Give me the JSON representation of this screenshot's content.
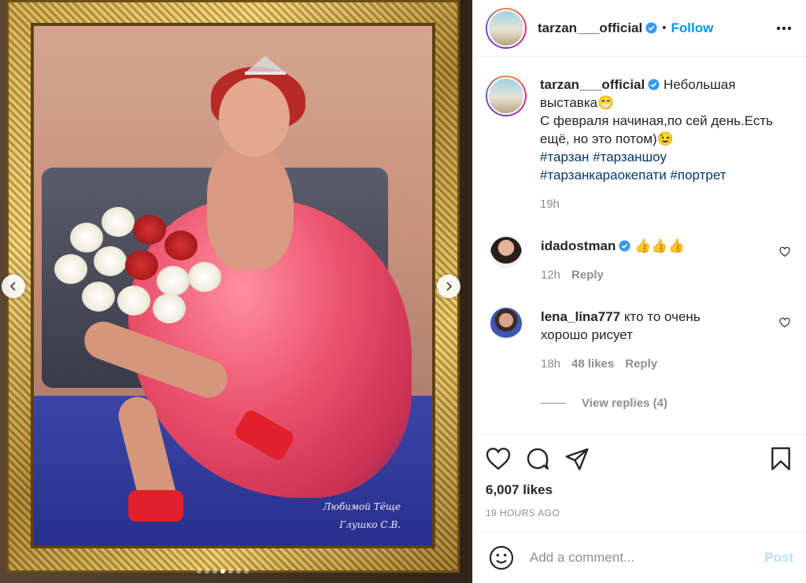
{
  "post": {
    "username": "tarzan___official",
    "follow_label": "Follow",
    "separator": "•",
    "caption_text": "Небольшая выставка😁\nС февраля начиная,по сей день.Есть ещё, но это потом)😉",
    "caption_line1": "Небольшая",
    "caption_line2": "выставка😁",
    "caption_line3": "С февраля начиная,по сей день.Есть",
    "caption_line4": "ещё, но это потом)😉",
    "hashtags": [
      "#тарзан",
      "#тарзаншоу",
      "#тарзанкараокепати",
      "#портрет"
    ],
    "caption_time": "19h",
    "likes": "6,007 likes",
    "posted_ago": "19 HOURS AGO",
    "painting_signature_line1": "Любимой Тёще",
    "painting_signature_line2": "Глушко С.В.",
    "carousel": {
      "count": 7,
      "active_index": 3
    }
  },
  "comments": [
    {
      "username": "idadostman",
      "verified": true,
      "text": "👍👍👍",
      "time": "12h",
      "likes": "",
      "reply_label": "Reply"
    },
    {
      "username": "lena_lina777",
      "verified": false,
      "text_line1": "кто то очень",
      "text_line2": "хорошо рисует",
      "time": "18h",
      "likes": "48 likes",
      "reply_label": "Reply"
    }
  ],
  "view_replies": "View replies (4)",
  "add_comment": {
    "placeholder": "Add a comment...",
    "post_label": "Post"
  },
  "icons": {
    "verified": "verified-badge-icon",
    "more": "more-options-icon",
    "like": "heart-icon",
    "comment": "comment-icon",
    "share": "share-icon",
    "save": "bookmark-icon",
    "emoji": "emoji-icon",
    "prev": "chevron-left-icon",
    "next": "chevron-right-icon"
  },
  "colors": {
    "accent": "#0095f6",
    "text": "#262626",
    "muted": "#8e8e8e",
    "post_disabled": "#b2dffc",
    "hashtag": "#00376b"
  }
}
